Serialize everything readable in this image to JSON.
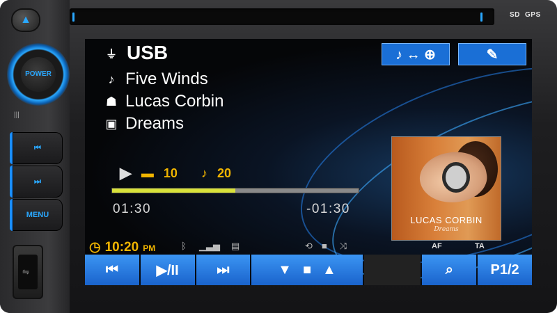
{
  "device": {
    "top_labels": [
      "SD",
      "GPS"
    ],
    "buttons": {
      "eject": "▲",
      "power": "POWER",
      "prev": "⏮",
      "next": "⏭",
      "menu": "MENU"
    },
    "mic_symbol": "|||"
  },
  "screen": {
    "source": "USB",
    "track": "Five Winds",
    "artist": "Lucas Corbin",
    "album": "Dreams",
    "folder_count": "10",
    "track_count": "20",
    "progress_fraction": 0.5,
    "time_elapsed": "01:30",
    "time_remaining": "-01:30",
    "clock": {
      "time": "10:20",
      "ampm": "PM"
    },
    "album_art": {
      "artist_text": "LUCAS CORBIN",
      "album_text": "Dreams"
    },
    "top_buttons": {
      "mode": "♪ ↔ ⊕",
      "settings": "🔧"
    },
    "af_label": "AF",
    "ta_label": "TA",
    "bottom_buttons": {
      "prev": "⏮",
      "play_pause": "▶/II",
      "next": "⏭",
      "down": "▼",
      "folder": "■",
      "up": "▲",
      "search": "🔍",
      "page": "P1/2"
    }
  },
  "colors": {
    "accent_blue": "#1a6fd6",
    "highlight_yellow": "#f0b400",
    "progress_fill": "#d9e23a"
  }
}
